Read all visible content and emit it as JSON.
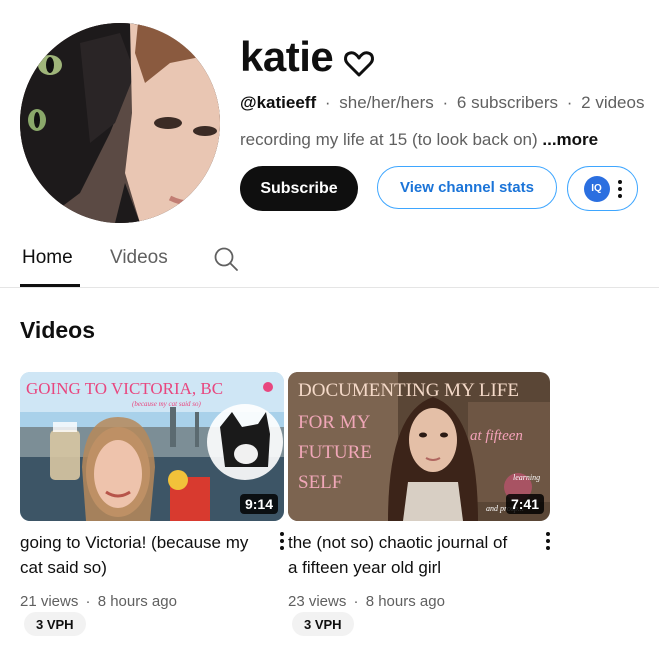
{
  "channel": {
    "name": "katie",
    "handle": "@katieeff",
    "pronouns": "she/her/hers",
    "subscribers": "6 subscribers",
    "videos_count": "2 videos",
    "separator": "·",
    "description": "recording my life at 15 (to look back on)",
    "more_label": "...more"
  },
  "buttons": {
    "subscribe": "Subscribe",
    "view_stats": "View channel stats",
    "extension_logo": "IQ"
  },
  "tabs": [
    {
      "label": "Home",
      "active": true
    },
    {
      "label": "Videos",
      "active": false
    }
  ],
  "section": {
    "title": "Videos"
  },
  "videos": [
    {
      "title": "going to Victoria! (because my cat said so)",
      "views": "21 views",
      "age": "8 hours ago",
      "duration": "9:14",
      "vph": "3 VPH",
      "thumb_text": "GOING TO VICTORIA, BC",
      "thumb_subtext": "(because my cat said so)"
    },
    {
      "title": "the (not so) chaotic journal of a fifteen year old girl",
      "views": "23 views",
      "age": "8 hours ago",
      "duration": "7:41",
      "vph": "3 VPH",
      "thumb_text_line1": "DOCUMENTING MY LIFE",
      "thumb_text_line2": "FOR MY",
      "thumb_text_line3": "FUTURE",
      "thumb_text_line4": "SELF",
      "thumb_side": "at fifteen",
      "thumb_small": "learning",
      "thumb_small2": "and prosp..."
    }
  ],
  "colors": {
    "accent_blue": "#1b74d8",
    "outline_blue": "#3ea6ff",
    "text_primary": "#0f0f0f",
    "text_secondary": "#606060"
  },
  "icons": [
    "heart-icon",
    "search-icon",
    "more-vert-icon"
  ]
}
